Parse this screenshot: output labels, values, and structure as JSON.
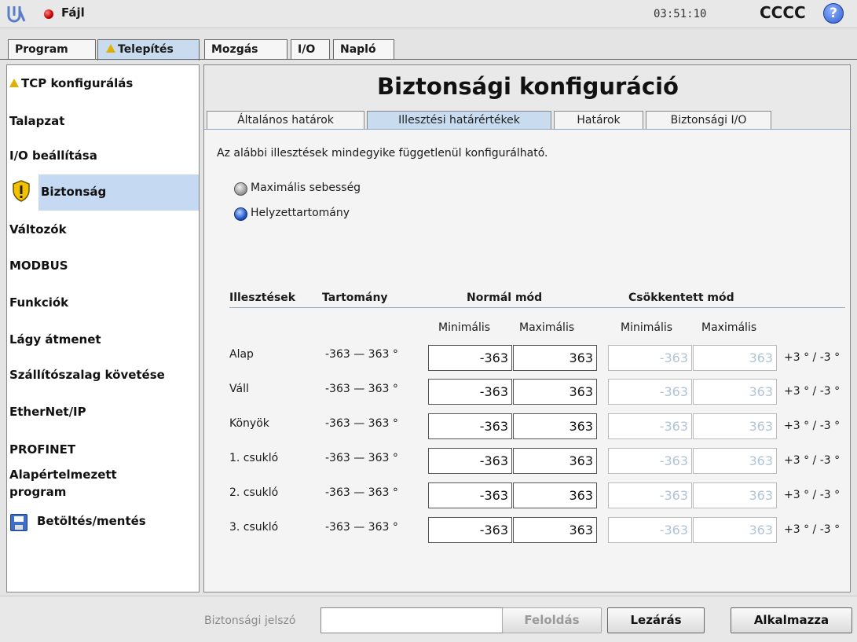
{
  "topbar": {
    "file_label": "Fájl",
    "clock": "03:51:10",
    "robot_name": "CCCC",
    "help": "?"
  },
  "main_tabs": [
    "Program",
    "Telepítés",
    "Mozgás",
    "I/O",
    "Napló"
  ],
  "sidebar": [
    "TCP konfigurálás",
    "Talapzat",
    "I/O beállítása",
    "Biztonság",
    "Változók",
    "MODBUS",
    "Funkciók",
    "Lágy átmenet",
    "Szállítószalag követése",
    "EtherNet/IP",
    "PROFINET",
    "Alapértelmezett",
    "program",
    "Betöltés/mentés"
  ],
  "page": {
    "title": "Biztonsági konfiguráció",
    "subtabs": [
      "Általános határok",
      "Illesztési határértékek",
      "Határok",
      "Biztonsági I/O"
    ],
    "description": "Az alábbi illesztések mindegyike függetlenül konfigurálható.",
    "radio": [
      "Maximális sebesség",
      "Helyzettartomány"
    ],
    "selected_radio": "Helyzettartomány",
    "table": {
      "headers": {
        "joints": "Illesztések",
        "range": "Tartomány",
        "normal": "Normál mód",
        "reduced": "Csökkentett mód"
      },
      "subheaders": {
        "n_min": "Minimális",
        "n_max": "Maximális",
        "r_min": "Minimális",
        "r_max": "Maximális"
      },
      "rows": [
        {
          "name": "Alap",
          "range": "-363 — 363 °",
          "n_min": "-363",
          "n_max": "363",
          "r_min": "-363",
          "r_max": "363",
          "tol": "+3 ° / -3 °"
        },
        {
          "name": "Váll",
          "range": "-363 — 363 °",
          "n_min": "-363",
          "n_max": "363",
          "r_min": "-363",
          "r_max": "363",
          "tol": "+3 ° / -3 °"
        },
        {
          "name": "Könyök",
          "range": "-363 — 363 °",
          "n_min": "-363",
          "n_max": "363",
          "r_min": "-363",
          "r_max": "363",
          "tol": "+3 ° / -3 °"
        },
        {
          "name": "1. csukló",
          "range": "-363 — 363 °",
          "n_min": "-363",
          "n_max": "363",
          "r_min": "-363",
          "r_max": "363",
          "tol": "+3 ° / -3 °"
        },
        {
          "name": "2. csukló",
          "range": "-363 — 363 °",
          "n_min": "-363",
          "n_max": "363",
          "r_min": "-363",
          "r_max": "363",
          "tol": "+3 ° / -3 °"
        },
        {
          "name": "3. csukló",
          "range": "-363 — 363 °",
          "n_min": "-363",
          "n_max": "363",
          "r_min": "-363",
          "r_max": "363",
          "tol": "+3 ° / -3 °"
        }
      ]
    }
  },
  "bottom": {
    "password_label": "Biztonsági jelszó",
    "password_value": "",
    "unlock": "Feloldás",
    "lock": "Lezárás",
    "apply": "Alkalmazza"
  }
}
